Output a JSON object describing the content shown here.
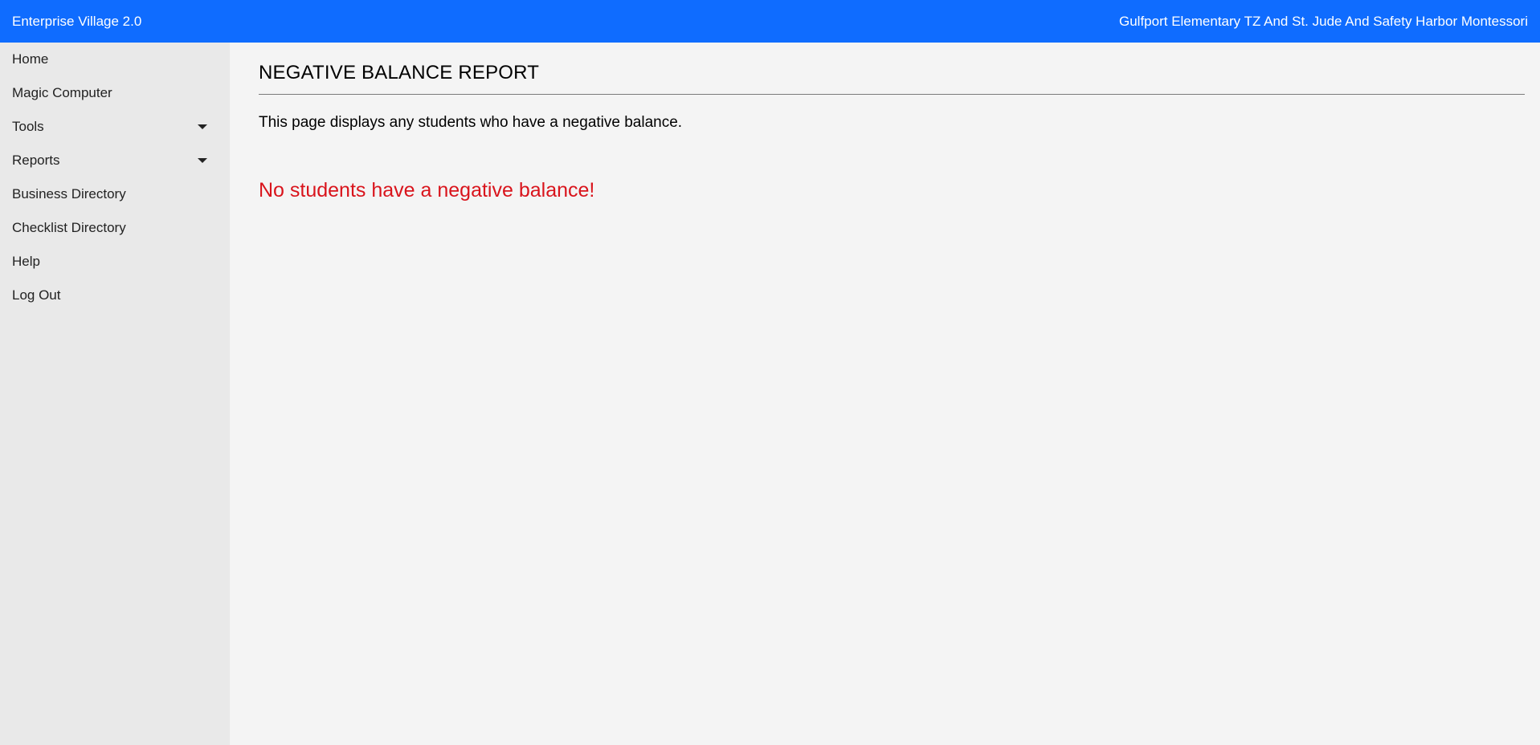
{
  "header": {
    "app_title": "Enterprise Village 2.0",
    "school_name": "Gulfport Elementary TZ And St. Jude And Safety Harbor Montessori",
    "color": "#0f6cff"
  },
  "sidebar": {
    "items": [
      {
        "label": "Home"
      },
      {
        "label": "Magic Computer"
      },
      {
        "label": "Tools",
        "icon": "caret-down-icon"
      },
      {
        "label": "Reports",
        "icon": "caret-down-icon"
      },
      {
        "label": "Business Directory"
      },
      {
        "label": "Checklist Directory"
      },
      {
        "label": "Help"
      },
      {
        "label": "Log Out"
      }
    ]
  },
  "main": {
    "title": "NEGATIVE BALANCE REPORT",
    "description": "This page displays any students who have a negative balance.",
    "empty_message": "No students have a negative balance!",
    "empty_message_color": "#d9141c"
  }
}
